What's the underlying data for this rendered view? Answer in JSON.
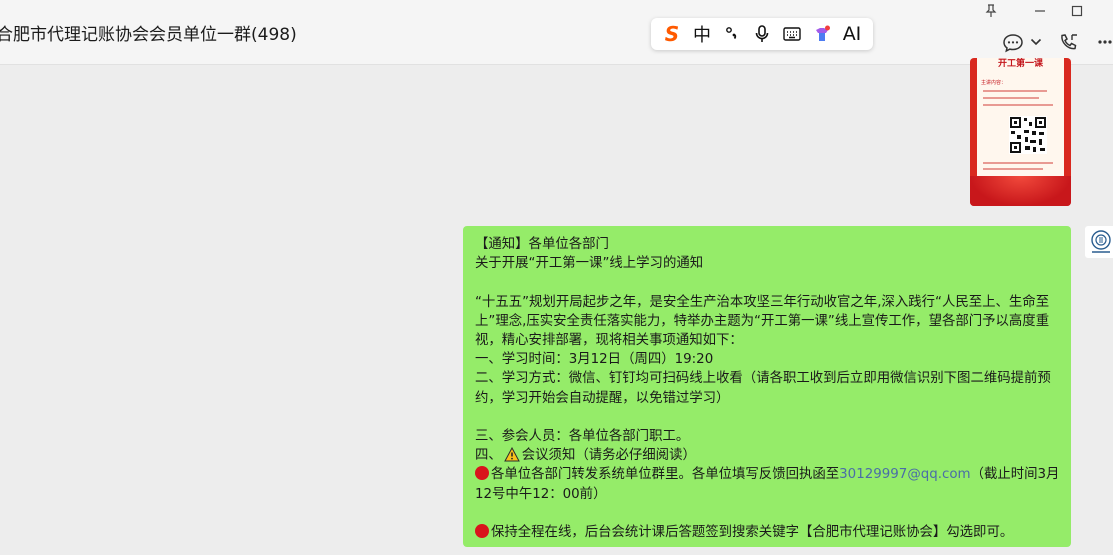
{
  "header": {
    "title": "合肥市代理记账协会会员单位一群(498)"
  },
  "ime_toolbar": {
    "items": [
      "中",
      "°,",
      "mic",
      "keyboard",
      "skin",
      "AI"
    ],
    "logo": "S",
    "accent": "#ff5a00"
  },
  "image_message": {
    "poster_title": "开工第一课",
    "poster_section": "主讲内容："
  },
  "message": {
    "lines": [
      "【通知】各单位各部门",
      "关于开展“开工第一课”线上学习的通知",
      "",
      "    “十五五”规划开局起步之年，是安全生产治本攻坚三年行动收官之年,深入践行“人民至上、生命至上”理念,压实安全责任落实能力，特举办主题为“开工第一课”线上宣传工作，望各部门予以高度重视，精心安排部署，现将相关事项通知如下：",
      "一、学习时间：3月12日（周四）19:20",
      "二、学习方式：微信、钉钉均可扫码线上收看（请各职工收到后立即用微信识别下图二维码提前预约，学习开始会自动提醒，以免错过学习）",
      "",
      "三、参会人员：各单位各部门职工。"
    ],
    "meeting_prefix": "四、",
    "meeting_text": "会议须知（请务必仔细阅读）",
    "bullet1_text": "各单位各部门转发系统单位群里。各单位填写反馈回执函至",
    "bullet1_email": "30129997@qq.com",
    "bullet1_tail": "（截止时间3月12号中午12：00前）",
    "bullet2_text": "保持全程在线，后台会统计课后答题签到搜索关键字【合肥市代理记账协会】勾选即可。",
    "bubble_color": "#95ec69"
  }
}
